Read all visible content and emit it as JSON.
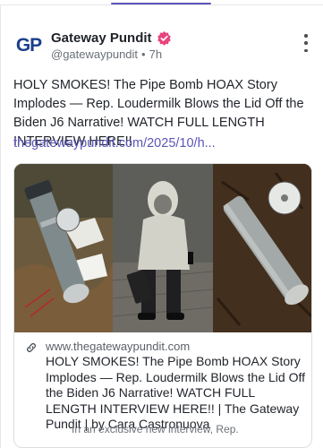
{
  "post": {
    "author": {
      "display_name": "Gateway Pundit",
      "handle": "@gatewaypundit",
      "separator": "•",
      "time_ago": "7h",
      "avatar_text": "GP",
      "verified_color": "#e8447e"
    },
    "text": "HOLY SMOKES! The Pipe Bomb HOAX Story Implodes — Rep. Loudermilk Blows the Lid Off the Biden J6 Narrative! WATCH FULL LENGTH INTERVIEW HERE!!",
    "link_text": "thegatewaypundit.com/2025/10/h...",
    "link_color": "#5b55b8"
  },
  "link_card": {
    "domain": "www.thegatewaypundit.com",
    "title": "HOLY SMOKES! The Pipe Bomb HOAX Story Implodes — Rep. Loudermilk Blows the Lid Off the Biden J6 Narrative! WATCH FULL LENGTH INTERVIEW HERE!! | The Gateway Pundit | by Cara Castronuova",
    "description": "In an exclusive new interview, Rep.",
    "image_panels": [
      "pipe-bomb-photo",
      "hooded-suspect-photo",
      "pipe-bomb-closeup-photo"
    ]
  },
  "icons": {
    "more": "more-vertical-icon",
    "verified": "verified-badge-icon",
    "link": "link-icon"
  }
}
